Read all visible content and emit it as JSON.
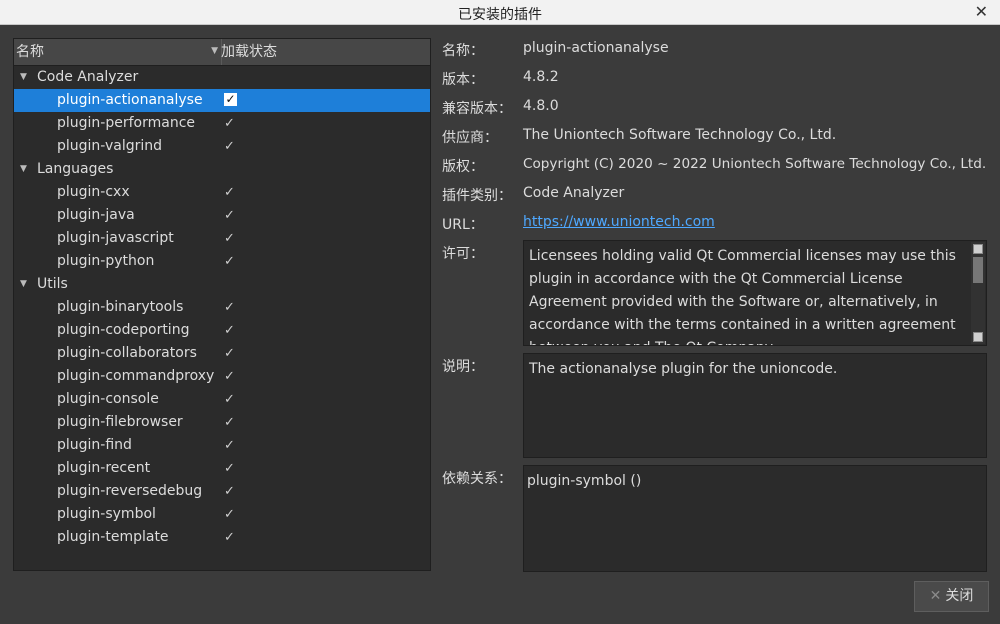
{
  "window": {
    "title": "已安装的插件"
  },
  "tree": {
    "columns": {
      "name": "名称",
      "status": "加载状态"
    },
    "groups": [
      {
        "label": "Code Analyzer",
        "items": [
          {
            "name": "plugin-actionanalyse",
            "checked": true,
            "selected": true
          },
          {
            "name": "plugin-performance",
            "checked": true
          },
          {
            "name": "plugin-valgrind",
            "checked": true
          }
        ]
      },
      {
        "label": "Languages",
        "items": [
          {
            "name": "plugin-cxx",
            "checked": true
          },
          {
            "name": "plugin-java",
            "checked": true
          },
          {
            "name": "plugin-javascript",
            "checked": true
          },
          {
            "name": "plugin-python",
            "checked": true
          }
        ]
      },
      {
        "label": "Utils",
        "items": [
          {
            "name": "plugin-binarytools",
            "checked": true
          },
          {
            "name": "plugin-codeporting",
            "checked": true
          },
          {
            "name": "plugin-collaborators",
            "checked": true
          },
          {
            "name": "plugin-commandproxy",
            "checked": true
          },
          {
            "name": "plugin-console",
            "checked": true
          },
          {
            "name": "plugin-filebrowser",
            "checked": true
          },
          {
            "name": "plugin-find",
            "checked": true
          },
          {
            "name": "plugin-recent",
            "checked": true
          },
          {
            "name": "plugin-reversedebug",
            "checked": true
          },
          {
            "name": "plugin-symbol",
            "checked": true
          },
          {
            "name": "plugin-template",
            "checked": true
          }
        ]
      }
    ]
  },
  "details": {
    "name_label": "名称：",
    "name": "plugin-actionanalyse",
    "version_label": "版本：",
    "version": "4.8.2",
    "compat_label": "兼容版本：",
    "compat_version": "4.8.0",
    "vendor_label": "供应商：",
    "vendor": "The Uniontech Software Technology Co., Ltd.",
    "copyright_label": "版权：",
    "copyright": "Copyright (C) 2020 ~ 2022 Uniontech Software Technology Co., Ltd.",
    "category_label": "插件类别：",
    "category": "Code Analyzer",
    "url_label": "URL：",
    "url": "https://www.uniontech.com",
    "license_label": "许可：",
    "license_text": "Licensees holding valid Qt Commercial licenses may use this plugin in accordance with the Qt Commercial License Agreement provided with the Software or, alternatively, in accordance with the terms contained in a written agreement between you and The Qt Company.",
    "description_label": "说明：",
    "description": "The actionanalyse plugin for the unioncode.",
    "dependencies_label": "依赖关系：",
    "dependencies": "plugin-symbol ()"
  },
  "buttons": {
    "close": "关闭"
  }
}
